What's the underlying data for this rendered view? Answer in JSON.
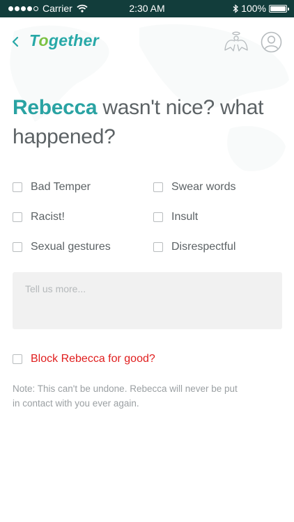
{
  "status_bar": {
    "carrier": "Carrier",
    "time": "2:30 AM",
    "battery": "100%"
  },
  "nav": {
    "logo_prefix": "T",
    "logo_o": "o",
    "logo_suffix": "gether"
  },
  "heading": {
    "name": "Rebecca",
    "rest": " wasn't nice? what happened?"
  },
  "reasons": [
    {
      "label": "Bad Temper",
      "checked": false
    },
    {
      "label": "Swear words",
      "checked": false
    },
    {
      "label": "Racist!",
      "checked": false
    },
    {
      "label": "Insult",
      "checked": false
    },
    {
      "label": "Sexual gestures",
      "checked": false
    },
    {
      "label": "Disrespectful",
      "checked": false
    }
  ],
  "details": {
    "placeholder": "Tell us more...",
    "value": ""
  },
  "block": {
    "label": "Block Rebecca for good?",
    "checked": false,
    "note": "Note: This can't be undone. Rebecca will never be put in contact with you ever again."
  },
  "colors": {
    "status_bar_bg": "#123d3b",
    "brand_teal": "#2aa3a3",
    "logo_accent_green": "#7bc142",
    "danger_red": "#e01d1d"
  }
}
